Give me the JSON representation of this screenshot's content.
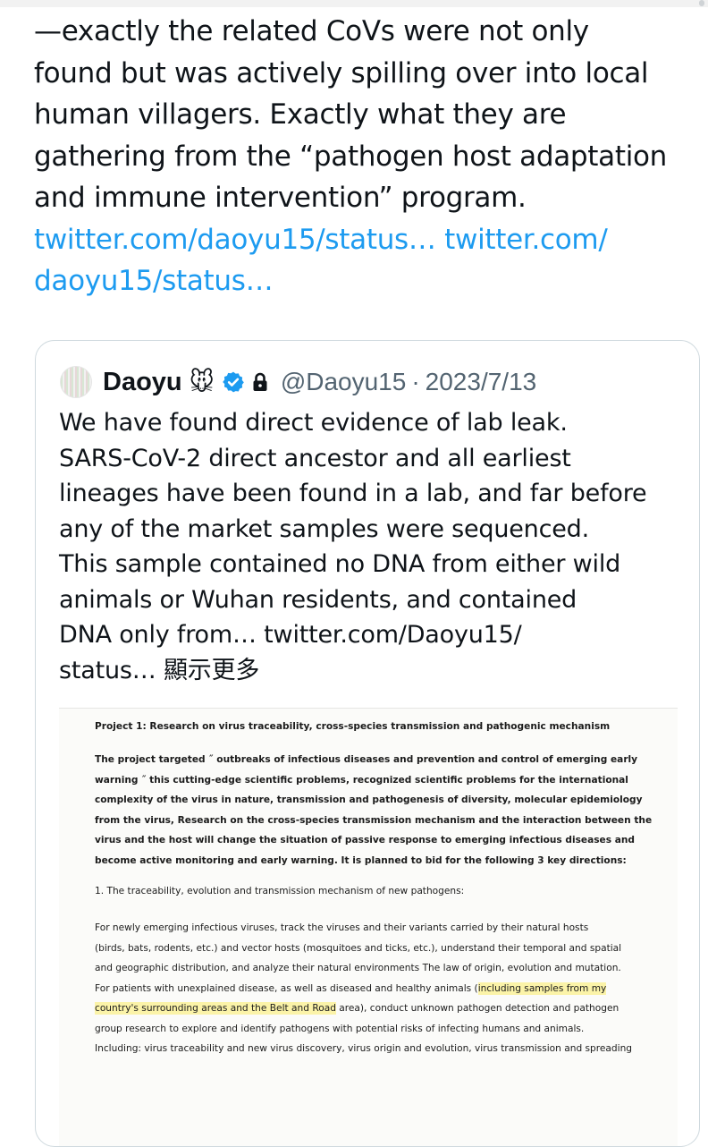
{
  "tweet": {
    "lines": [
      "—exactly the related CoVs were not only",
      "found but was actively spilling over into local",
      "human villagers. Exactly what they are",
      "gathering from the “pathogen host adaptation",
      "and immune intervention” program."
    ],
    "link_line_1a": "twitter.com/daoyu15/status…",
    "link_line_1b": "twitter.com/",
    "link_line_2": "daoyu15/status…"
  },
  "quote": {
    "author_name": "Daoyu",
    "emoji": "🐭",
    "handle": "@Daoyu15",
    "separator": "·",
    "date": "2023/7/13",
    "icons": {
      "avatar": "avatar-image",
      "verified": "verified-badge-icon",
      "lock": "lock-icon"
    },
    "colors": {
      "link": "#1d9bf0",
      "verified": "#1d9bf0",
      "muted": "#536471"
    },
    "text_lines": [
      "We have found direct evidence of lab leak.",
      "SARS-CoV-2 direct ancestor and all earliest",
      "lineages have been found in a lab, and far before",
      "any of the market samples were sequenced.",
      "This sample contained no DNA from either wild",
      "animals or Wuhan residents, and contained"
    ],
    "last_line_text": "DNA only from…",
    "last_line_link": "twitter.com/Daoyu15/",
    "final_link": "status…",
    "show_more": "顯示更多"
  },
  "document": {
    "title": "Project 1: Research on virus traceability, cross-species transmission and pathogenic mechanism",
    "intro_lines": [
      "The project targeted ˝ outbreaks of infectious diseases and prevention and control of emerging early",
      "warning ˝ this cutting-edge scientific problems, recognized scientific problems for the international",
      "complexity of the virus in nature, transmission and pathogenesis of diversity, molecular epidemiology",
      "from the virus, Research on the cross-species transmission mechanism and the interaction between the",
      "virus and the host will change the situation of passive response to emerging infectious diseases and",
      "become active monitoring and early warning. It is planned to bid for the following 3 key directions:"
    ],
    "section_heading": "1. The traceability, evolution and transmission mechanism of new pathogens:",
    "body_lines": [
      "For newly emerging infectious viruses, track the viruses and their variants carried by their natural hosts",
      "(birds, bats, rodents, etc.) and vector hosts (mosquitoes and ticks, etc.), understand their temporal and spatial",
      "and geographic distribution, and analyze their natural environments The law of origin, evolution and mutation."
    ],
    "hl_line_1_pre": "For patients with unexplained disease, as well as diseased and healthy animals (",
    "hl_line_1_hl": "including samples from my",
    "hl_line_2_hl": "country's surrounding areas and the Belt and Road",
    "hl_line_2_post": " area), conduct unknown pathogen detection and pathogen",
    "tail_lines": [
      "group research to explore and identify pathogens with potential risks of infecting humans and animals.",
      "Including: virus traceability and new virus discovery, virus origin and evolution, virus transmission and spreading"
    ]
  }
}
